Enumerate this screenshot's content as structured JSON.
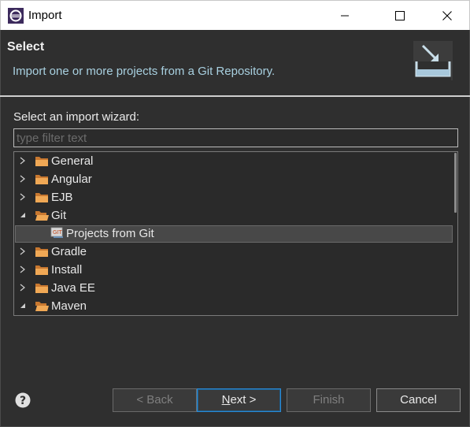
{
  "window": {
    "title": "Import",
    "minimize_icon": "minimize-icon",
    "maximize_icon": "maximize-icon",
    "close_icon": "close-icon"
  },
  "header": {
    "title": "Select",
    "description": "Import one or more projects from a Git Repository."
  },
  "wizard": {
    "label": "Select an import wizard:",
    "filter_placeholder": "type filter text",
    "filter_value": ""
  },
  "tree": {
    "items": [
      {
        "label": "General",
        "expanded": false,
        "depth": 0,
        "icon": "folder-icon"
      },
      {
        "label": "Angular",
        "expanded": false,
        "depth": 0,
        "icon": "folder-icon"
      },
      {
        "label": "EJB",
        "expanded": false,
        "depth": 0,
        "icon": "folder-icon"
      },
      {
        "label": "Git",
        "expanded": true,
        "depth": 0,
        "icon": "folder-icon"
      },
      {
        "label": "Projects from Git",
        "expanded": null,
        "depth": 1,
        "icon": "git-project-icon",
        "selected": true
      },
      {
        "label": "Gradle",
        "expanded": false,
        "depth": 0,
        "icon": "folder-icon"
      },
      {
        "label": "Install",
        "expanded": false,
        "depth": 0,
        "icon": "folder-icon"
      },
      {
        "label": "Java EE",
        "expanded": false,
        "depth": 0,
        "icon": "folder-icon"
      },
      {
        "label": "Maven",
        "expanded": true,
        "depth": 0,
        "icon": "folder-icon"
      }
    ]
  },
  "footer": {
    "back_label": "< Back",
    "next_label_mnemonic": "N",
    "next_label_rest": "ext >",
    "finish_label": "Finish",
    "cancel_label": "Cancel"
  },
  "colors": {
    "background": "#2f2f2f",
    "description_text": "#a8d0e0",
    "default_button_border": "#2a8ad4",
    "folder": "#e8a050"
  }
}
